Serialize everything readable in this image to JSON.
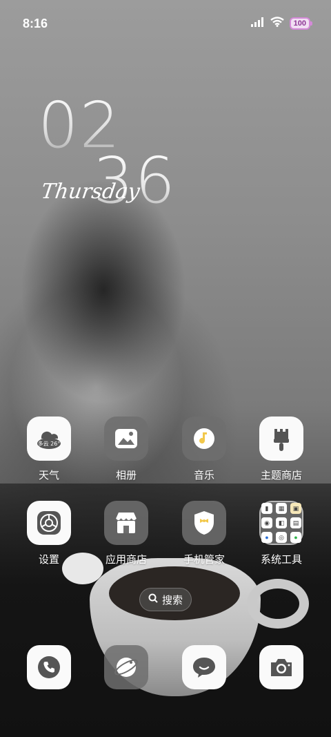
{
  "status_bar": {
    "time": "8:16",
    "battery": "100"
  },
  "clock": {
    "hour": "02",
    "minute": "36",
    "weekday": "Thursday"
  },
  "weather_widget_icon_text": "多云 26°",
  "apps_row1": [
    {
      "label": "天气",
      "icon": "weather-icon"
    },
    {
      "label": "相册",
      "icon": "gallery-icon"
    },
    {
      "label": "音乐",
      "icon": "music-icon"
    },
    {
      "label": "主题商店",
      "icon": "theme-store-icon"
    }
  ],
  "apps_row2": [
    {
      "label": "设置",
      "icon": "settings-icon"
    },
    {
      "label": "应用商店",
      "icon": "app-store-icon"
    },
    {
      "label": "手机管家",
      "icon": "phone-manager-icon"
    },
    {
      "label": "系统工具",
      "icon": "system-tools-folder-icon"
    }
  ],
  "search": {
    "label": "搜索"
  },
  "dock": [
    {
      "icon": "phone-icon"
    },
    {
      "icon": "browser-icon"
    },
    {
      "icon": "messages-icon"
    },
    {
      "icon": "camera-icon"
    }
  ],
  "colors": {
    "battery_accent": "#d48ad8",
    "icon_light": "#fafafa",
    "icon_dark": "#6e6e6e",
    "music_yellow": "#f2c84b"
  }
}
